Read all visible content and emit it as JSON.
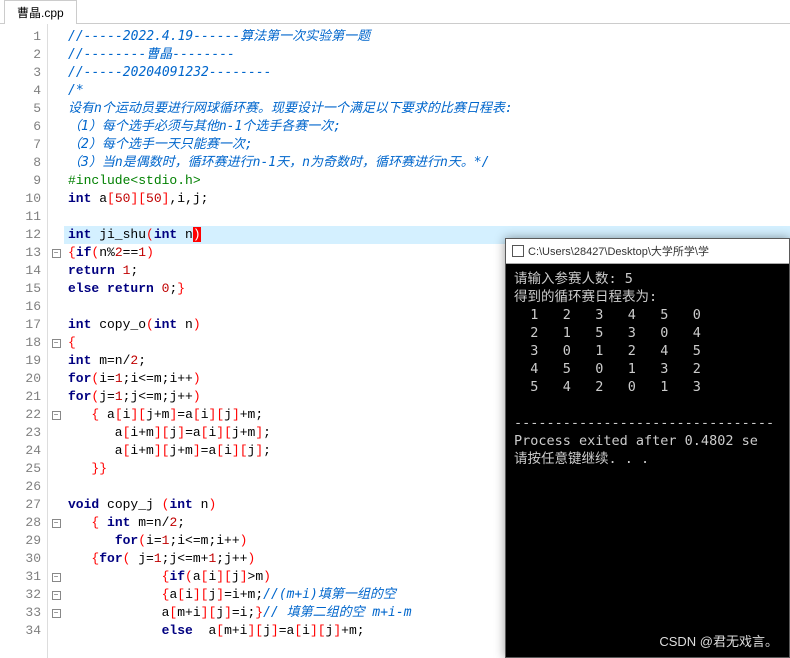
{
  "tab": {
    "title": "曹晶.cpp"
  },
  "gutter": [
    "1",
    "2",
    "3",
    "4",
    "5",
    "6",
    "7",
    "8",
    "9",
    "10",
    "11",
    "12",
    "13",
    "14",
    "15",
    "16",
    "17",
    "18",
    "19",
    "20",
    "21",
    "22",
    "23",
    "24",
    "25",
    "26",
    "27",
    "28",
    "29",
    "30",
    "31",
    "32",
    "33",
    "34"
  ],
  "fold": [
    "",
    "",
    "",
    "",
    "",
    "",
    "",
    "",
    "",
    "",
    "",
    "",
    "minus",
    "",
    "",
    "",
    "",
    "minus",
    "",
    "",
    "",
    "minus",
    "",
    "",
    "",
    "",
    "",
    "minus",
    "",
    "",
    "minus",
    "minus",
    "minus",
    "",
    ""
  ],
  "code": [
    {
      "cls": "",
      "html": "<span class='c-comment'>//-----2022.4.19------算法第一次实验第一题</span>"
    },
    {
      "cls": "",
      "html": "<span class='c-comment'>//--------曹晶--------</span>"
    },
    {
      "cls": "",
      "html": "<span class='c-comment'>//-----20204091232--------</span>"
    },
    {
      "cls": "",
      "html": "<span class='c-comment'>/*</span>"
    },
    {
      "cls": "",
      "html": "<span class='c-comment'>设有n个运动员要进行网球循环赛。现要设计一个满足以下要求的比赛日程表:</span>"
    },
    {
      "cls": "",
      "html": "<span class='c-comment'>（1）每个选手必须与其他n-1个选手各赛一次;</span>"
    },
    {
      "cls": "",
      "html": "<span class='c-comment'>（2）每个选手一天只能赛一次;</span>"
    },
    {
      "cls": "",
      "html": "<span class='c-comment'>（3）当n是偶数时，循环赛进行n-1天，n为奇数时，循环赛进行n天。*/</span>"
    },
    {
      "cls": "",
      "html": "<span class='c-preproc'>#include&lt;stdio.h&gt;</span>"
    },
    {
      "cls": "",
      "html": "<span class='c-type'>int</span> a<span class='c-bracket'>[</span><span class='c-num'>50</span><span class='c-bracket'>][</span><span class='c-num'>50</span><span class='c-bracket'>]</span>,i,j;"
    },
    {
      "cls": "",
      "html": ""
    },
    {
      "cls": "hl-line",
      "html": "<span class='c-type'>int</span> ji_shu<span class='c-bracket'>(</span><span class='c-type'>int</span> n<span style='background:#ff0000;color:#fff;'>)</span>"
    },
    {
      "cls": "",
      "html": "<span class='c-bracket'>{</span><span class='c-keyword'>if</span><span class='c-bracket'>(</span>n%<span class='c-num'>2</span>==<span class='c-num'>1</span><span class='c-bracket'>)</span>"
    },
    {
      "cls": "",
      "html": "<span class='c-keyword'>return</span> <span class='c-num'>1</span>;"
    },
    {
      "cls": "",
      "html": "<span class='c-keyword'>else</span> <span class='c-keyword'>return</span> <span class='c-num'>0</span>;<span class='c-bracket'>}</span>"
    },
    {
      "cls": "",
      "html": ""
    },
    {
      "cls": "",
      "html": "<span class='c-type'>int</span> copy_o<span class='c-bracket'>(</span><span class='c-type'>int</span> n<span class='c-bracket'>)</span>"
    },
    {
      "cls": "",
      "html": "<span class='c-bracket'>{</span>"
    },
    {
      "cls": "",
      "html": "<span class='c-type'>int</span> m=n/<span class='c-num'>2</span>;"
    },
    {
      "cls": "",
      "html": "<span class='c-keyword'>for</span><span class='c-bracket'>(</span>i=<span class='c-num'>1</span>;i&lt;=m;i++<span class='c-bracket'>)</span>"
    },
    {
      "cls": "",
      "html": "<span class='c-keyword'>for</span><span class='c-bracket'>(</span>j=<span class='c-num'>1</span>;j&lt;=m;j++<span class='c-bracket'>)</span>"
    },
    {
      "cls": "",
      "html": "   <span class='c-bracket'>{</span> a<span class='c-bracket'>[</span>i<span class='c-bracket'>][</span>j+m<span class='c-bracket'>]</span>=a<span class='c-bracket'>[</span>i<span class='c-bracket'>][</span>j<span class='c-bracket'>]</span>+m;"
    },
    {
      "cls": "",
      "html": "      a<span class='c-bracket'>[</span>i+m<span class='c-bracket'>][</span>j<span class='c-bracket'>]</span>=a<span class='c-bracket'>[</span>i<span class='c-bracket'>][</span>j+m<span class='c-bracket'>]</span>;"
    },
    {
      "cls": "",
      "html": "      a<span class='c-bracket'>[</span>i+m<span class='c-bracket'>][</span>j+m<span class='c-bracket'>]</span>=a<span class='c-bracket'>[</span>i<span class='c-bracket'>][</span>j<span class='c-bracket'>]</span>;"
    },
    {
      "cls": "",
      "html": "   <span class='c-bracket'>}}</span>"
    },
    {
      "cls": "",
      "html": ""
    },
    {
      "cls": "",
      "html": "<span class='c-type'>void</span> copy_j <span class='c-bracket'>(</span><span class='c-type'>int</span> n<span class='c-bracket'>)</span>"
    },
    {
      "cls": "",
      "html": "   <span class='c-bracket'>{</span> <span class='c-type'>int</span> m=n/<span class='c-num'>2</span>;"
    },
    {
      "cls": "",
      "html": "      <span class='c-keyword'>for</span><span class='c-bracket'>(</span>i=<span class='c-num'>1</span>;i&lt;=m;i++<span class='c-bracket'>)</span>"
    },
    {
      "cls": "",
      "html": "   <span class='c-bracket'>{</span><span class='c-keyword'>for</span><span class='c-bracket'>(</span> j=<span class='c-num'>1</span>;j&lt;=m+<span class='c-num'>1</span>;j++<span class='c-bracket'>)</span>"
    },
    {
      "cls": "",
      "html": "            <span class='c-bracket'>{</span><span class='c-keyword'>if</span><span class='c-bracket'>(</span>a<span class='c-bracket'>[</span>i<span class='c-bracket'>][</span>j<span class='c-bracket'>]</span>&gt;m<span class='c-bracket'>)</span>"
    },
    {
      "cls": "",
      "html": "            <span class='c-bracket'>{</span>a<span class='c-bracket'>[</span>i<span class='c-bracket'>][</span>j<span class='c-bracket'>]</span>=i+m;<span class='c-comment'>//(m+i)填第一组的空</span>"
    },
    {
      "cls": "",
      "html": "            a<span class='c-bracket'>[</span>m+i<span class='c-bracket'>][</span>j<span class='c-bracket'>]</span>=i;<span class='c-bracket'>}</span><span class='c-comment'>// 填第二组的空 m+i-m</span>"
    },
    {
      "cls": "",
      "html": "            <span class='c-keyword'>else</span>  a<span class='c-bracket'>[</span>m+i<span class='c-bracket'>][</span>j<span class='c-bracket'>]</span>=a<span class='c-bracket'>[</span>i<span class='c-bracket'>][</span>j<span class='c-bracket'>]</span>+m;"
    }
  ],
  "console": {
    "title": "C:\\Users\\28427\\Desktop\\大学所学\\学",
    "prompt": "请输入参赛人数: ",
    "input": "5",
    "result_label": "得到的循环赛日程表为:",
    "table": [
      [
        1,
        2,
        3,
        4,
        5,
        0
      ],
      [
        2,
        1,
        5,
        3,
        0,
        4
      ],
      [
        3,
        0,
        1,
        2,
        4,
        5
      ],
      [
        4,
        5,
        0,
        1,
        3,
        2
      ],
      [
        5,
        4,
        2,
        0,
        1,
        3
      ]
    ],
    "sep": "--------------------------------",
    "exit_msg": "Process exited after 0.4802 se",
    "continue_msg": "请按任意键继续. . ."
  },
  "watermark": "CSDN @君无戏言。"
}
